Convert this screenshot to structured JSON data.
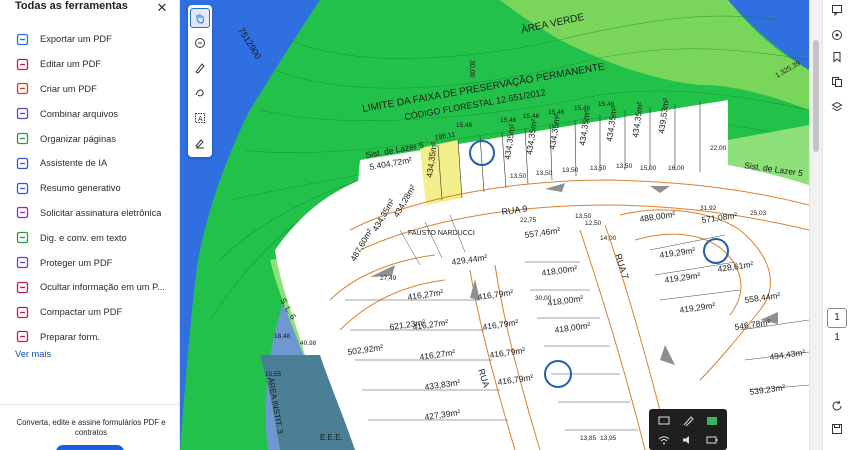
{
  "tools_panel": {
    "title": "Todas as ferramentas",
    "items": [
      {
        "label": "Exportar um PDF",
        "icon": "export-pdf-icon",
        "color": "#2a6ed6"
      },
      {
        "label": "Editar um PDF",
        "icon": "edit-pdf-icon",
        "color": "#c2175b"
      },
      {
        "label": "Criar um PDF",
        "icon": "create-pdf-icon",
        "color": "#d9372b"
      },
      {
        "label": "Combinar arquivos",
        "icon": "combine-files-icon",
        "color": "#6a3fc0"
      },
      {
        "label": "Organizar páginas",
        "icon": "organize-pages-icon",
        "color": "#2f9b3e"
      },
      {
        "label": "Assistente de IA",
        "icon": "ai-assistant-icon",
        "color": "#3a57c9"
      },
      {
        "label": "Resumo generativo",
        "icon": "generative-summary-icon",
        "color": "#3a57c9"
      },
      {
        "label": "Solicitar assinatura eletrônica",
        "icon": "request-signature-icon",
        "color": "#8c2fb2"
      },
      {
        "label": "Dig. e conv. em texto",
        "icon": "scan-ocr-icon",
        "color": "#2f9b3e"
      },
      {
        "label": "Proteger um PDF",
        "icon": "protect-pdf-icon",
        "color": "#6a3fc0"
      },
      {
        "label": "Ocultar informação em um P...",
        "icon": "redact-icon",
        "color": "#c2175b"
      },
      {
        "label": "Compactar um PDF",
        "icon": "compress-pdf-icon",
        "color": "#c2175b"
      },
      {
        "label": "Preparar form.",
        "icon": "prepare-form-icon",
        "color": "#c2175b"
      }
    ],
    "see_more": "Ver mais",
    "promo_text": "Converta, edite e assine formulários PDF e contratos"
  },
  "tool_rail": [
    "hand-icon",
    "add-comment-icon",
    "highlight-pen-icon",
    "draw-icon",
    "text-select-icon",
    "fill-sign-icon"
  ],
  "right_rail": {
    "icons": [
      "comments-icon",
      "ai-chat-icon",
      "bookmarks-icon",
      "thumbnails-icon",
      "layers-icon",
      "refresh-icon",
      "save-icon"
    ],
    "current_page": "1",
    "total_pages": "1"
  },
  "map": {
    "labels": {
      "area_verde": "ÁREA VERDE",
      "faixa": "LIMITE DA FAIXA DE PRESERVAÇÃO PERMANENTE",
      "codigo": "CÓDIGO FLORESTAL 12.651/2012",
      "coord": "7512900",
      "lazer5_left": "Sist. de Lazer 5",
      "lazer5_area": "5.404,72m²",
      "lazer5_right": "Sist. de Lazer 5",
      "rua9": "RUA 9",
      "rua7": "RUA 7",
      "rua": "RUA",
      "sl6": "S. L. 6",
      "instit": "ÁREA INSTIT. 3",
      "eee": "E.E.E.",
      "dist_30": "30,00",
      "val_19811": "198,11",
      "val_132539": "1.325,39",
      "watermark": "FAUSTO NARDUCCI"
    },
    "lot_values": [
      "434,35m²",
      "434,35m²",
      "434,35m²",
      "434,35m²",
      "439,53m²",
      "434,35m²",
      "434,35m²",
      "434,35m²",
      "434,28m²",
      "434,35m²",
      "487,60m²",
      "557,46m²",
      "429,44m²",
      "416,79m²",
      "418,00m²",
      "418,00m²",
      "418,00m²",
      "416,79m²",
      "416,79m²",
      "416,79m²",
      "416,27m²",
      "416,27m²",
      "416,27m²",
      "433,83m²",
      "502,92m²",
      "621,23m²",
      "427,39m²",
      "488,00m²",
      "571,08m²",
      "419,29m²",
      "419,29m²",
      "428,61m²",
      "419,29m²",
      "558,44m²",
      "546,78m²",
      "494,43m²",
      "539,23m²"
    ],
    "dimensions": [
      "15,46",
      "15,46",
      "15,46",
      "15,46",
      "15,46",
      "15,46",
      "13,50",
      "13,50",
      "13,50",
      "13,50",
      "13,50",
      "15,00",
      "16,00",
      "22,00",
      "31,92",
      "22,75",
      "30,00",
      "13,50",
      "12,50",
      "14,00",
      "25,03",
      "27,49",
      "40,98",
      "18,48",
      "15,55",
      "13,85",
      "13,95"
    ]
  },
  "colors": {
    "water": "#2f6fe0",
    "buffer": "#22c24a",
    "green_area": "#7ad65a",
    "lot_area": "#ffffff",
    "highlight_lot": "#f2ee8a",
    "instit": "#4b7f95",
    "road_line": "#d9812f",
    "accent": "#1b5ee0"
  }
}
